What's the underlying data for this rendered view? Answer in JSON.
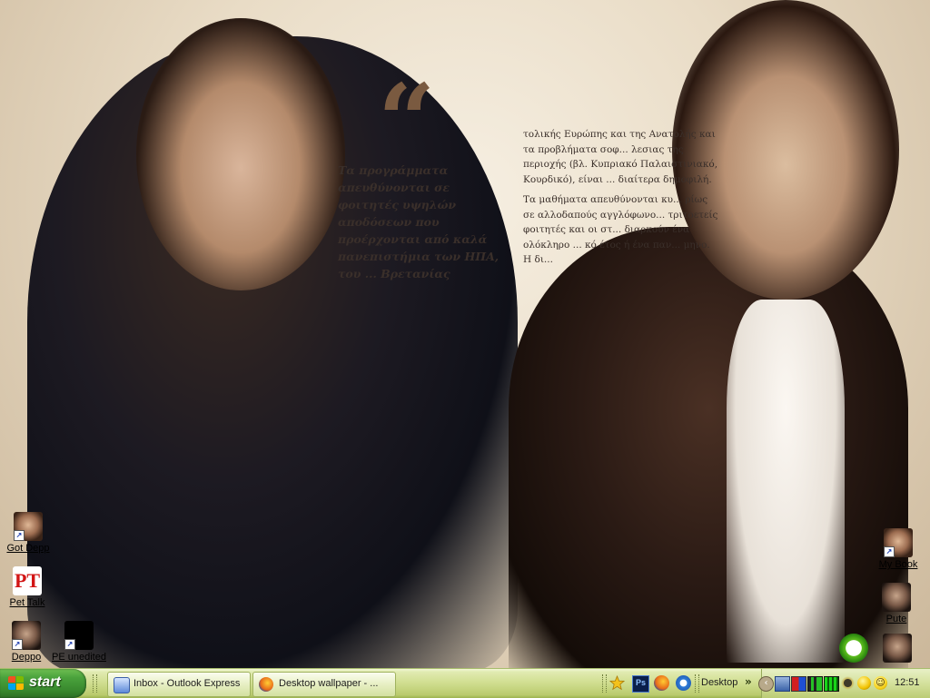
{
  "wallpaper": {
    "quote_mark": "“",
    "quote_text": "Τα προγράμματα απευθύνονται σε φοιτητές υψηλών αποδόσεων που προέρχονται από καλά πανεπιστήμια των ΗΠΑ, του ... Βρετανίας",
    "body_paragraph_1": "τολικής Ευρώπης και της Ανατολής και τα προβλήματα σοφ... λεσιας της περιοχής (βλ. Κυπριακό Παλαιστινιακό, Κουρδικό), είναι ... διαίτερα δημοφιλή.",
    "body_paragraph_2": "Τα μαθήματα απευθύνονται κυ... ρίως σε αλλοδαπούς αγγλόφωνο... τριτοετείς φοιτητές και οι στ... διαρκούν ένα ολόκληρο ... κό έτος ή ένα παν... μηνο. Η δι..."
  },
  "desktop_icons": {
    "got_depp": "Got Depp",
    "pet_talk": "Pet Talk",
    "deppo": "Deppo",
    "pe_unedited": "PE unedited",
    "my_book": "My Book",
    "pute": "Pute",
    "pet_talk_glyph": "PT"
  },
  "taskbar": {
    "start_label": "start",
    "tasks": [
      {
        "label": "Inbox - Outlook Express"
      },
      {
        "label": "Desktop wallpaper - ..."
      }
    ],
    "desktop_toolbar_label": "Desktop",
    "overflow_chevron": "»",
    "clock": "12:51"
  },
  "colors": {
    "taskbar": "#cfdd8e",
    "start_button": "#3a8b2f",
    "icon_label": "#000000"
  },
  "icons": {
    "quick_launch": [
      "star-icon",
      "photoshop-icon",
      "firefox-icon",
      "internet-explorer-icon"
    ],
    "tray": [
      "back-arrow-icon",
      "network-icon",
      "security-flag-icon",
      "volume-meter-icon",
      "green-bars-icon",
      "bug-icon",
      "aim-icon",
      "messenger-smiley-icon"
    ]
  }
}
